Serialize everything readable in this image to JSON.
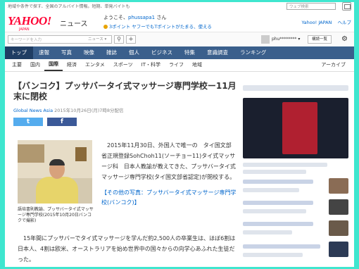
{
  "topbar": {
    "notice": "地域や条件で探す、全国のアルバイト情報。短期、単発バイトも",
    "search_placeholder": "ウェブ検索"
  },
  "header": {
    "logo": "YAHOO!",
    "logo_sub": "JAPAN",
    "service": "ニュース",
    "welcome_prefix": "ようこそ、",
    "username": "phussapa1",
    "welcome_suffix": " さん",
    "points": "3ポイント",
    "points_promo": "ヤフーでもTポイントがたまる、使える",
    "link_top": "Yahoo! JAPAN",
    "link_help": "ヘルプ"
  },
  "searchbar": {
    "placeholder": "キーワードを入力",
    "scope": "ニュース",
    "plus": "+",
    "account": "phu********",
    "memo": "構読一覧"
  },
  "nav": {
    "items": [
      "トップ",
      "速報",
      "写真",
      "映像",
      "雑誌",
      "個人",
      "ビジネス",
      "特集",
      "意識調査",
      "ランキング"
    ],
    "active": 0
  },
  "subnav": {
    "items": [
      "主要",
      "国内",
      "国際",
      "経済",
      "エンタメ",
      "スポーツ",
      "IT・科学",
      "ライフ",
      "地域"
    ],
    "active": 2,
    "archive": "アーカイブ"
  },
  "article": {
    "title": "【バンコク】プッサバータイ式マッサージ専門学校ー11月末に閉校",
    "source": "Global News Asia",
    "date": " 2015年10月26日(月)7時8分配信",
    "share_tw": "t",
    "share_fb": "f",
    "caption": "語培書則教諭、プッサバータイ式マッサージ専門学校(2015年10月20日バンコクで撮影)",
    "lead": "　2015年11月30日、外国人で唯一の　タイ国文部省正規登録SohChoh11(ソーチョー11)タイ式マッサージ科　日本人教諭が教えてきた、プッサバータイ式マッサージ専門学校(タイ国文部省認定)が閉校する。",
    "photo_link": "【その他の写真：プッサバータイ式マッサージ専門学校(バンコク)】",
    "body": "　15年間にプッサバーでタイ式マッサージを学んだ約2,500人の卒業生は、ほぼ6割は日本人、4割は欧米、オーストラリアを始め世界中の国々からの向学心あふれた生徒だった。"
  }
}
